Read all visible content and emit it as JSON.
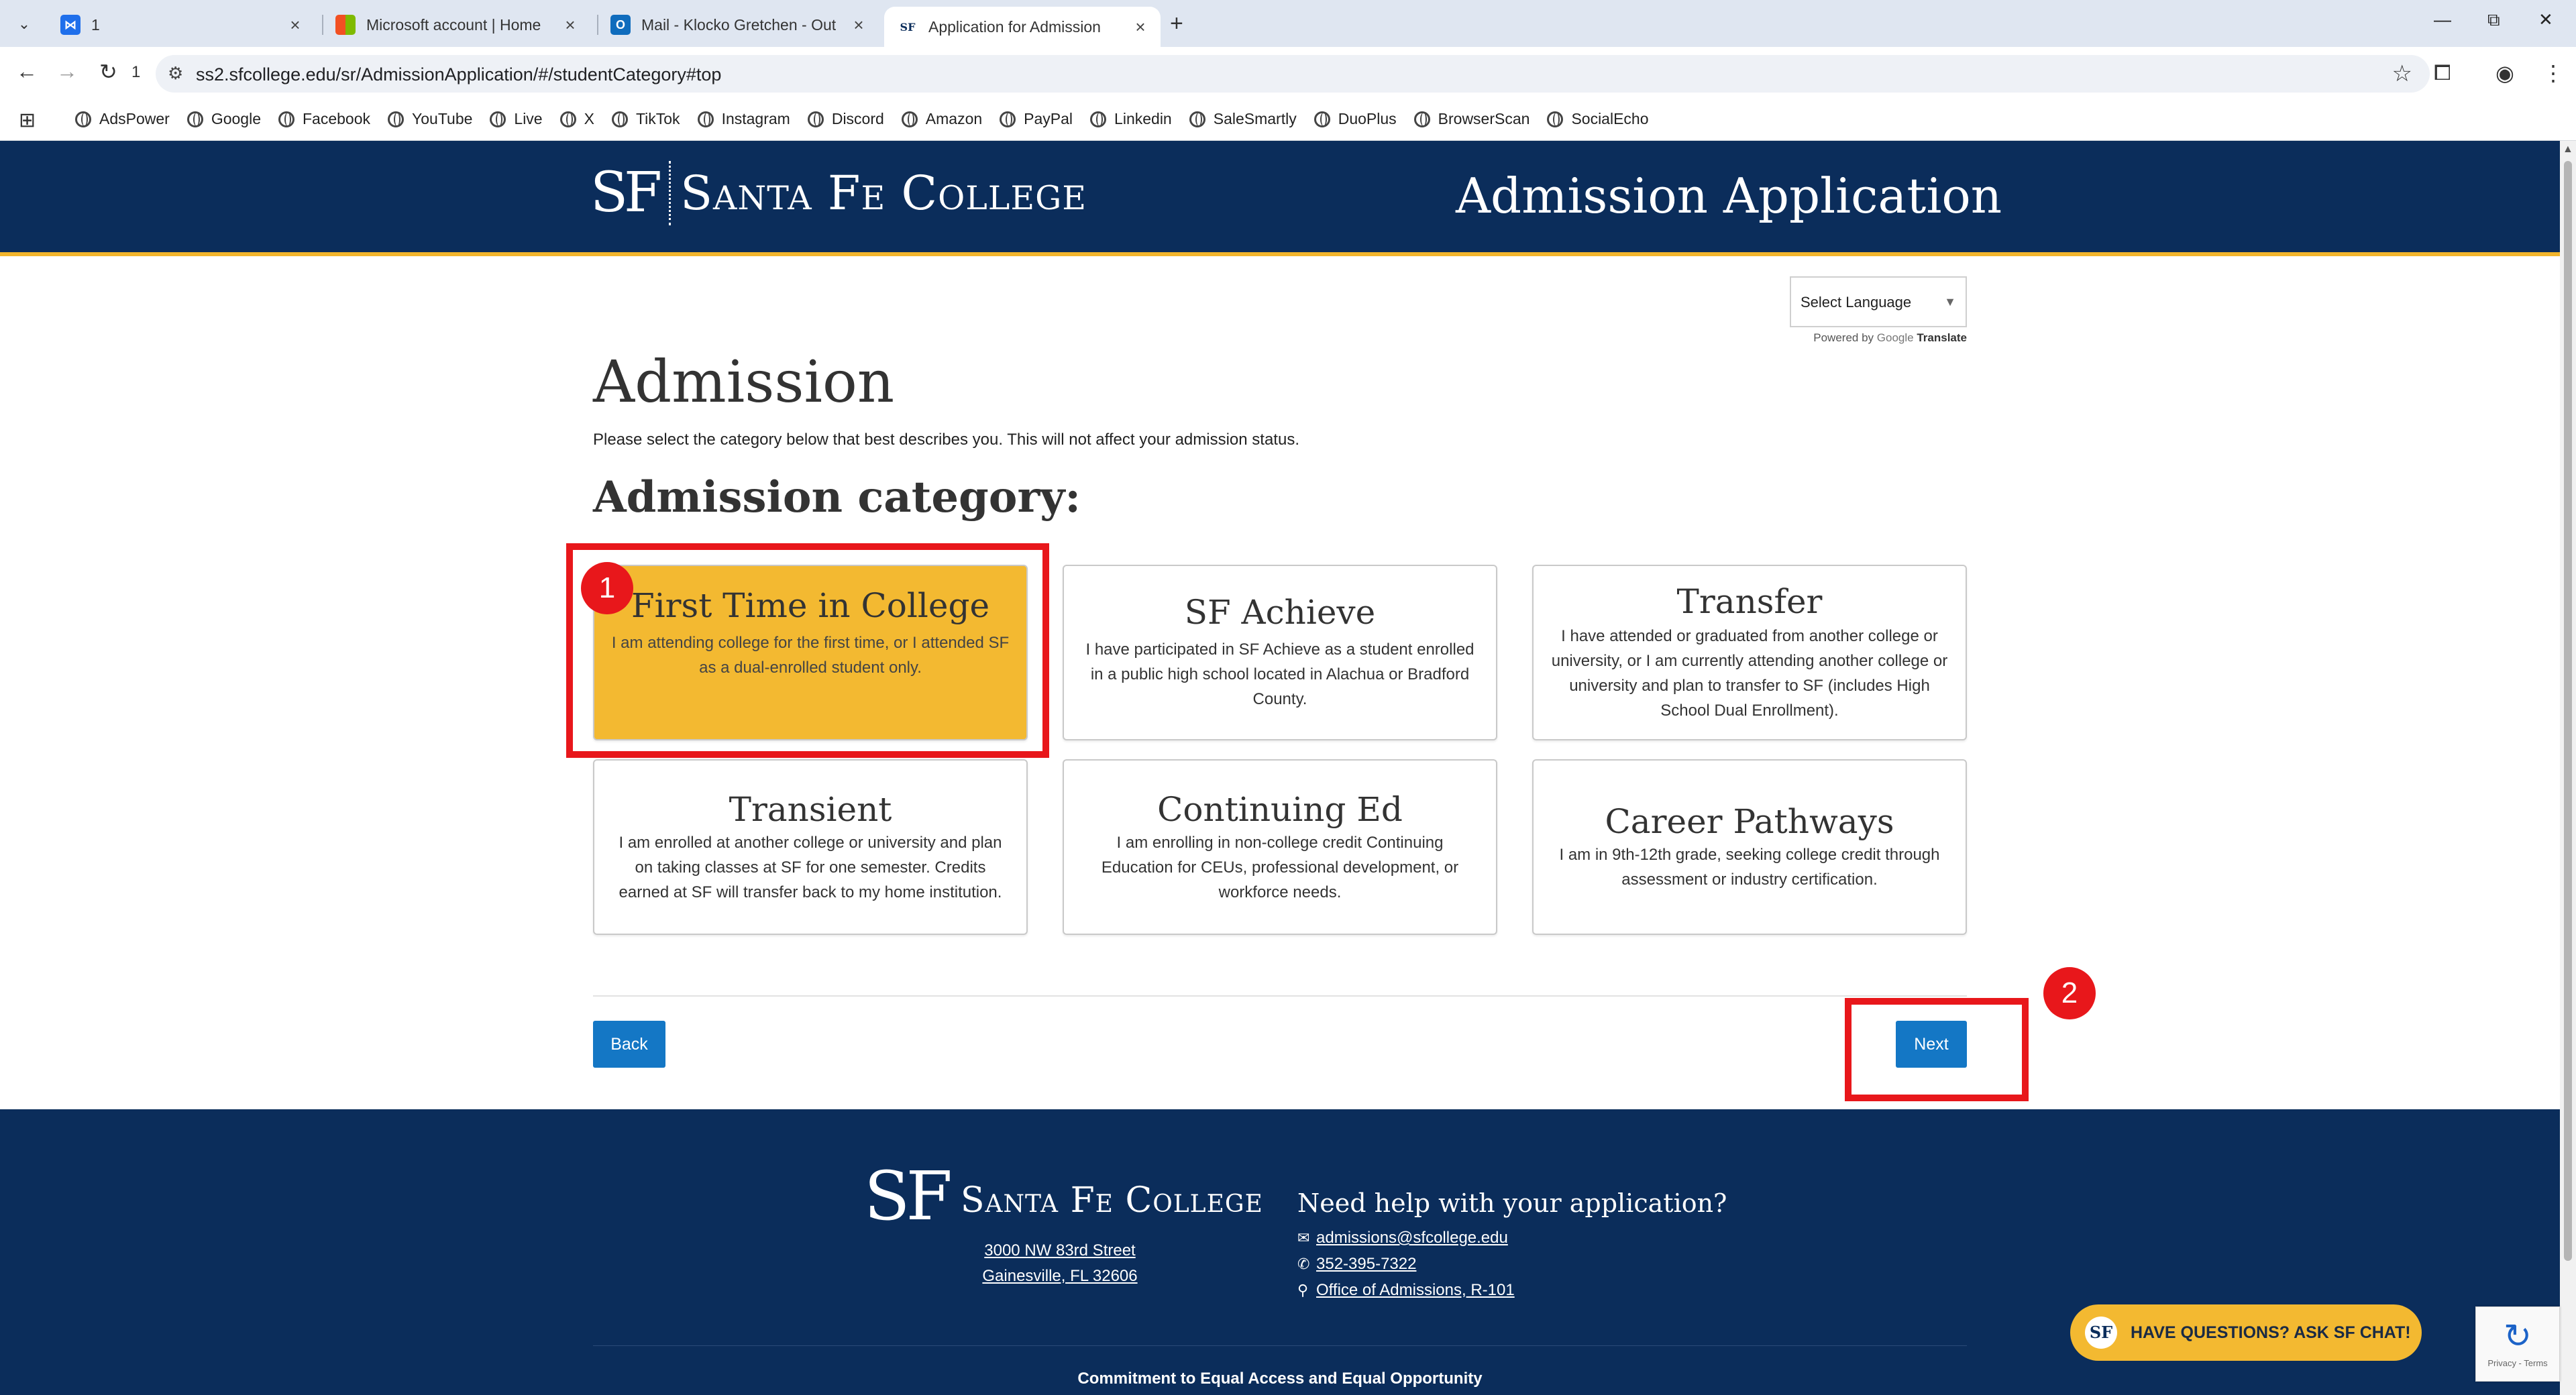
{
  "browser": {
    "tabs": [
      {
        "label": "1",
        "favicon": "app-icon",
        "color": "#1f6feb"
      },
      {
        "label": "Microsoft account | Home",
        "favicon": "microsoft-icon",
        "color": "#f25022"
      },
      {
        "label": "Mail - Klocko Gretchen - Out",
        "favicon": "outlook-icon",
        "color": "#0f6cbd"
      },
      {
        "label": "Application for Admission",
        "favicon": "sf-icon",
        "color": "#0b2d5b"
      }
    ],
    "url": "ss2.sfcollege.edu/sr/AdmissionApplication/#/studentCategory#top",
    "bookmarks": [
      "AdsPower",
      "Google",
      "Facebook",
      "YouTube",
      "Live",
      "X",
      "TikTok",
      "Instagram",
      "Discord",
      "Amazon",
      "PayPal",
      "Linkedin",
      "SaleSmartly",
      "DuoPlus",
      "BrowserScan",
      "SocialEcho"
    ]
  },
  "header": {
    "logo_mark": "SF",
    "logo_name": "Santa Fe College",
    "title": "Admission Application"
  },
  "translate": {
    "select_label": "Select Language",
    "powered_by": "Powered by",
    "google": "Google",
    "translate": "Translate"
  },
  "main": {
    "heading": "Admission",
    "intro": "Please select the category below that best describes you. This will not affect your admission status.",
    "category_heading": "Admission category:",
    "categories": [
      {
        "title": "First Time in College",
        "desc": "I am attending college for the first time, or I attended SF as a dual-enrolled student only.",
        "selected": true
      },
      {
        "title": "SF Achieve",
        "desc": "I have participated in SF Achieve as a student enrolled in a public high school located in Alachua or Bradford County."
      },
      {
        "title": "Transfer",
        "desc": "I have attended or graduated from another college or university, or I am currently attending another college or university and plan to transfer to SF (includes High School Dual Enrollment)."
      },
      {
        "title": "Transient",
        "desc": "I am enrolled at another college or university and plan on taking classes at SF for one semester. Credits earned at SF will transfer back to my home institution."
      },
      {
        "title": "Continuing Ed",
        "desc": "I am enrolling in non-college credit Continuing Education for CEUs, professional development, or workforce needs."
      },
      {
        "title": "Career Pathways",
        "desc": "I am in 9th-12th grade, seeking college credit through assessment or industry certification."
      }
    ],
    "back_label": "Back",
    "next_label": "Next"
  },
  "annotations": {
    "badge1": "1",
    "badge2": "2",
    "color": "#e8171b"
  },
  "footer": {
    "logo_mark": "SF",
    "logo_name": "Santa Fe College",
    "address_line1": "3000 NW 83rd Street",
    "address_line2": "Gainesville, FL 32606",
    "help_heading": "Need help with your application?",
    "email": "admissions@sfcollege.edu",
    "phone": "352-395-7322",
    "office": "Office of Admissions, R-101",
    "commitment": "Commitment to Equal Access and Equal Opportunity"
  },
  "chat": {
    "label": "HAVE QUESTIONS? ASK SF CHAT!",
    "logo": "SF"
  },
  "recaptcha": {
    "text": "Privacy - Terms"
  },
  "colors": {
    "navy": "#0b2d5b",
    "gold": "#f3b931",
    "button_blue": "#1477c5"
  }
}
